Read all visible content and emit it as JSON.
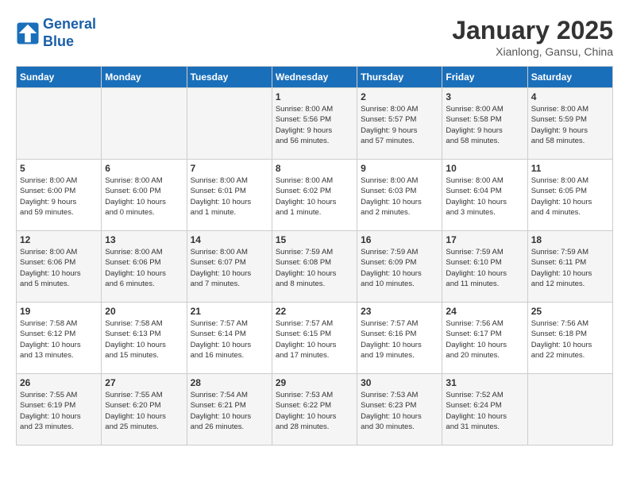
{
  "header": {
    "logo_line1": "General",
    "logo_line2": "Blue",
    "month": "January 2025",
    "location": "Xianlong, Gansu, China"
  },
  "weekdays": [
    "Sunday",
    "Monday",
    "Tuesday",
    "Wednesday",
    "Thursday",
    "Friday",
    "Saturday"
  ],
  "weeks": [
    [
      {
        "day": "",
        "info": ""
      },
      {
        "day": "",
        "info": ""
      },
      {
        "day": "",
        "info": ""
      },
      {
        "day": "1",
        "info": "Sunrise: 8:00 AM\nSunset: 5:56 PM\nDaylight: 9 hours\nand 56 minutes."
      },
      {
        "day": "2",
        "info": "Sunrise: 8:00 AM\nSunset: 5:57 PM\nDaylight: 9 hours\nand 57 minutes."
      },
      {
        "day": "3",
        "info": "Sunrise: 8:00 AM\nSunset: 5:58 PM\nDaylight: 9 hours\nand 58 minutes."
      },
      {
        "day": "4",
        "info": "Sunrise: 8:00 AM\nSunset: 5:59 PM\nDaylight: 9 hours\nand 58 minutes."
      }
    ],
    [
      {
        "day": "5",
        "info": "Sunrise: 8:00 AM\nSunset: 6:00 PM\nDaylight: 9 hours\nand 59 minutes."
      },
      {
        "day": "6",
        "info": "Sunrise: 8:00 AM\nSunset: 6:00 PM\nDaylight: 10 hours\nand 0 minutes."
      },
      {
        "day": "7",
        "info": "Sunrise: 8:00 AM\nSunset: 6:01 PM\nDaylight: 10 hours\nand 1 minute."
      },
      {
        "day": "8",
        "info": "Sunrise: 8:00 AM\nSunset: 6:02 PM\nDaylight: 10 hours\nand 1 minute."
      },
      {
        "day": "9",
        "info": "Sunrise: 8:00 AM\nSunset: 6:03 PM\nDaylight: 10 hours\nand 2 minutes."
      },
      {
        "day": "10",
        "info": "Sunrise: 8:00 AM\nSunset: 6:04 PM\nDaylight: 10 hours\nand 3 minutes."
      },
      {
        "day": "11",
        "info": "Sunrise: 8:00 AM\nSunset: 6:05 PM\nDaylight: 10 hours\nand 4 minutes."
      }
    ],
    [
      {
        "day": "12",
        "info": "Sunrise: 8:00 AM\nSunset: 6:06 PM\nDaylight: 10 hours\nand 5 minutes."
      },
      {
        "day": "13",
        "info": "Sunrise: 8:00 AM\nSunset: 6:06 PM\nDaylight: 10 hours\nand 6 minutes."
      },
      {
        "day": "14",
        "info": "Sunrise: 8:00 AM\nSunset: 6:07 PM\nDaylight: 10 hours\nand 7 minutes."
      },
      {
        "day": "15",
        "info": "Sunrise: 7:59 AM\nSunset: 6:08 PM\nDaylight: 10 hours\nand 8 minutes."
      },
      {
        "day": "16",
        "info": "Sunrise: 7:59 AM\nSunset: 6:09 PM\nDaylight: 10 hours\nand 10 minutes."
      },
      {
        "day": "17",
        "info": "Sunrise: 7:59 AM\nSunset: 6:10 PM\nDaylight: 10 hours\nand 11 minutes."
      },
      {
        "day": "18",
        "info": "Sunrise: 7:59 AM\nSunset: 6:11 PM\nDaylight: 10 hours\nand 12 minutes."
      }
    ],
    [
      {
        "day": "19",
        "info": "Sunrise: 7:58 AM\nSunset: 6:12 PM\nDaylight: 10 hours\nand 13 minutes."
      },
      {
        "day": "20",
        "info": "Sunrise: 7:58 AM\nSunset: 6:13 PM\nDaylight: 10 hours\nand 15 minutes."
      },
      {
        "day": "21",
        "info": "Sunrise: 7:57 AM\nSunset: 6:14 PM\nDaylight: 10 hours\nand 16 minutes."
      },
      {
        "day": "22",
        "info": "Sunrise: 7:57 AM\nSunset: 6:15 PM\nDaylight: 10 hours\nand 17 minutes."
      },
      {
        "day": "23",
        "info": "Sunrise: 7:57 AM\nSunset: 6:16 PM\nDaylight: 10 hours\nand 19 minutes."
      },
      {
        "day": "24",
        "info": "Sunrise: 7:56 AM\nSunset: 6:17 PM\nDaylight: 10 hours\nand 20 minutes."
      },
      {
        "day": "25",
        "info": "Sunrise: 7:56 AM\nSunset: 6:18 PM\nDaylight: 10 hours\nand 22 minutes."
      }
    ],
    [
      {
        "day": "26",
        "info": "Sunrise: 7:55 AM\nSunset: 6:19 PM\nDaylight: 10 hours\nand 23 minutes."
      },
      {
        "day": "27",
        "info": "Sunrise: 7:55 AM\nSunset: 6:20 PM\nDaylight: 10 hours\nand 25 minutes."
      },
      {
        "day": "28",
        "info": "Sunrise: 7:54 AM\nSunset: 6:21 PM\nDaylight: 10 hours\nand 26 minutes."
      },
      {
        "day": "29",
        "info": "Sunrise: 7:53 AM\nSunset: 6:22 PM\nDaylight: 10 hours\nand 28 minutes."
      },
      {
        "day": "30",
        "info": "Sunrise: 7:53 AM\nSunset: 6:23 PM\nDaylight: 10 hours\nand 30 minutes."
      },
      {
        "day": "31",
        "info": "Sunrise: 7:52 AM\nSunset: 6:24 PM\nDaylight: 10 hours\nand 31 minutes."
      },
      {
        "day": "",
        "info": ""
      }
    ]
  ]
}
